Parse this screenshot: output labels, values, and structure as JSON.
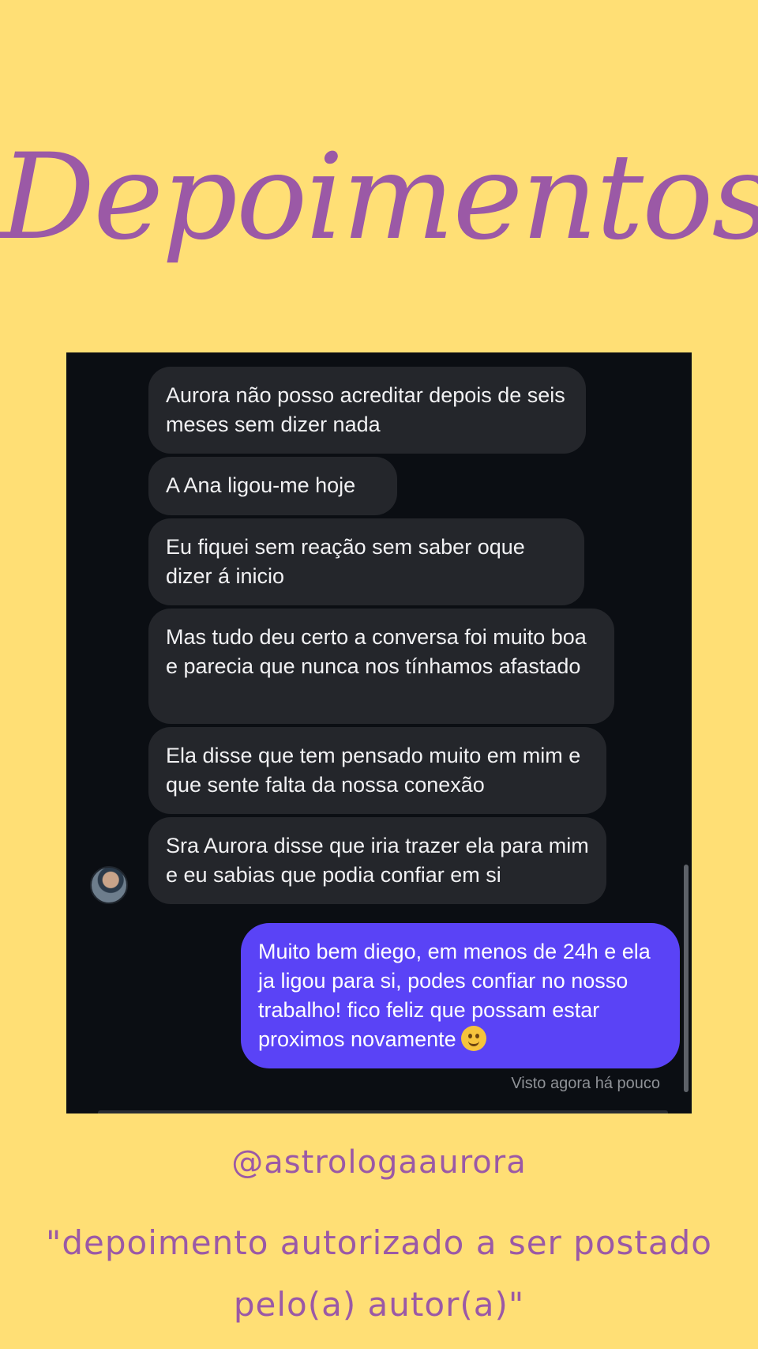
{
  "title": "Depoimentos",
  "chat": {
    "received": [
      "Aurora não posso acreditar depois de seis meses sem dizer nada",
      "A Ana ligou-me hoje",
      "Eu fiquei sem reação sem saber oque dizer á inicio",
      "Mas tudo deu certo a conversa foi muito boa e parecia que nunca nos tínhamos afastado",
      "Ela disse que tem pensado muito em mim e que sente falta da nossa conexão",
      "Sra Aurora disse que iria trazer ela para mim e eu sabias que podia confiar em si"
    ],
    "sent": "Muito bem diego, em menos de 24h e ela ja ligou para si, podes confiar no nosso trabalho! fico feliz que possam estar proximos novamente",
    "sent_emoji": "smiling-face-emoji",
    "seen": "Visto agora há pouco"
  },
  "handle": "@astrologaaurora",
  "caption": "\"depoimento autorizado a ser postado pelo(a) autor(a)\"",
  "colors": {
    "background": "#ffdf75",
    "accent": "#9b59a6",
    "chat_background": "#0b0e13",
    "received_bubble": "#24262b",
    "sent_bubble": "#5a43f6"
  }
}
